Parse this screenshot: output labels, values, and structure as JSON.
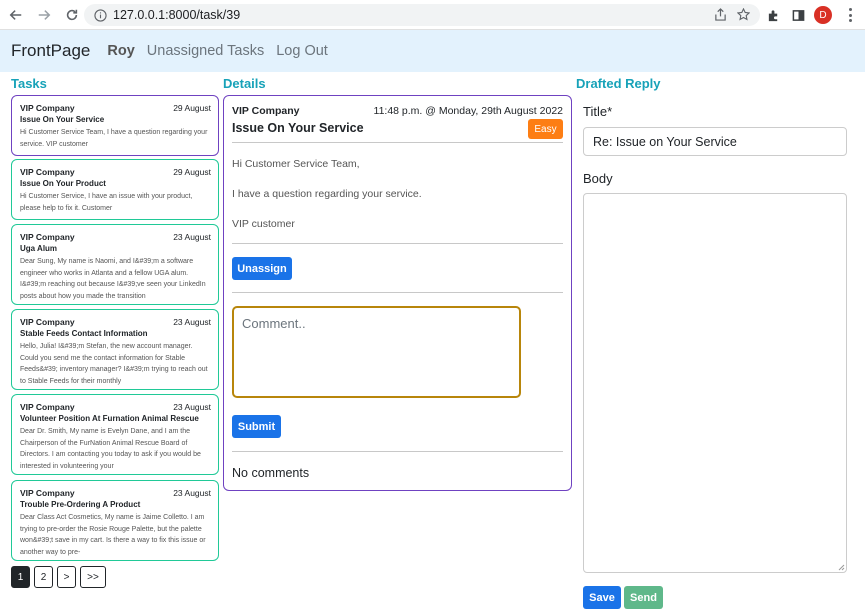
{
  "browser": {
    "url": "127.0.0.1:8000/task/39",
    "profile_initial": "D"
  },
  "navbar": {
    "brand": "FrontPage",
    "user": "Roy",
    "links": [
      "Unassigned Tasks",
      "Log Out"
    ]
  },
  "sections": {
    "tasks": "Tasks",
    "details": "Details",
    "reply": "Drafted Reply"
  },
  "tasks": [
    {
      "company": "VIP Company",
      "date": "29 August",
      "title": "Issue On Your Service",
      "body": "Hi Customer Service Team, I have a question regarding your service. VIP customer"
    },
    {
      "company": "VIP Company",
      "date": "29 August",
      "title": "Issue On Your Product",
      "body": "Hi Customer Service, I have an issue with your product, please help to fix it. Customer"
    },
    {
      "company": "VIP Company",
      "date": "23 August",
      "title": "Uga Alum",
      "body": "Dear Sung, My name is Naomi, and I&#39;m a software engineer who works in Atlanta and a fellow UGA alum. I&#39;m reaching out because I&#39;ve seen your LinkedIn posts about how you made the transition"
    },
    {
      "company": "VIP Company",
      "date": "23 August",
      "title": "Stable Feeds Contact Information",
      "body": "Hello, Julia! I&#39;m Stefan, the new account manager. Could you send me the contact information for Stable Feeds&#39; inventory manager? I&#39;m trying to reach out to Stable Feeds for their monthly"
    },
    {
      "company": "VIP Company",
      "date": "23 August",
      "title": "Volunteer Position At Furnation Animal Rescue",
      "body": "Dear Dr. Smith, My name is Evelyn Dane, and I am the Chairperson of the FurNation Animal Rescue Board of Directors. I am contacting you today to ask if you would be interested in volunteering your"
    },
    {
      "company": "VIP Company",
      "date": "23 August",
      "title": "Trouble Pre-Ordering A Product",
      "body": "Dear Class Act Cosmetics, My name is Jaime Colletto. I am trying to pre-order the Rosie Rouge Palette, but the palette won&#39;t save in my cart. Is there a way to fix this issue or another way to pre-"
    }
  ],
  "pagination": [
    "1",
    "2",
    ">",
    ">>"
  ],
  "details": {
    "company": "VIP Company",
    "timestamp": "11:48 p.m. @ Monday, 29th August 2022",
    "title": "Issue On Your Service",
    "badge": "Easy",
    "greeting": "Hi Customer Service Team,",
    "line": "I have a question regarding your service.",
    "signature": "VIP customer",
    "unassign_label": "Unassign",
    "comment_placeholder": "Comment..",
    "submit_label": "Submit",
    "no_comments": "No comments"
  },
  "reply": {
    "title_label": "Title*",
    "title_value": "Re: Issue on Your Service",
    "body_label": "Body",
    "save_label": "Save",
    "send_label": "Send"
  }
}
